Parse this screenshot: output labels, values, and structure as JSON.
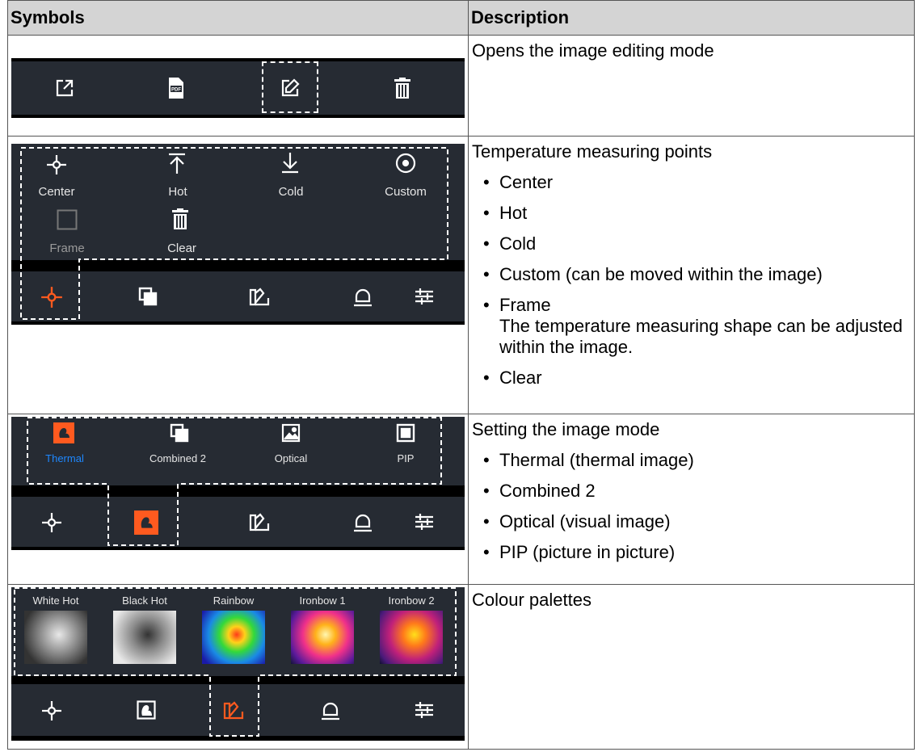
{
  "table": {
    "header_symbols": "Symbols",
    "header_description": "Description"
  },
  "row1": {
    "description": "Opens the image editing mode",
    "icons": [
      "export-icon",
      "pdf-icon",
      "edit-icon",
      "delete-icon"
    ]
  },
  "row2": {
    "description": "Temperature measuring points",
    "bullets": [
      "Center",
      "Hot",
      "Cold",
      "Custom (can be moved within the image)",
      "Frame"
    ],
    "frame_note": "The temperature measuring shape can be adjusted within the image.",
    "last_bullet": "Clear",
    "menu_labels": {
      "center": "Center",
      "hot": "Hot",
      "cold": "Cold",
      "custom": "Custom",
      "frame": "Frame",
      "clear": "Clear"
    }
  },
  "row3": {
    "description": "Setting the image mode",
    "bullets": [
      "Thermal (thermal image)",
      "Combined 2",
      "Optical (visual image)",
      "PIP (picture in picture)"
    ],
    "menu_labels": {
      "thermal": "Thermal",
      "combined": "Combined 2",
      "optical": "Optical",
      "pip": "PIP"
    }
  },
  "row4": {
    "description": "Colour palettes",
    "palettes": [
      "White Hot",
      "Black Hot",
      "Rainbow",
      "Ironbow 1",
      "Ironbow 2"
    ]
  },
  "colors": {
    "panel_bg": "#262b33",
    "accent_orange": "#ff5a1f",
    "thermal_label_blue": "#1e88ff",
    "header_bg": "#d4d4d4"
  }
}
